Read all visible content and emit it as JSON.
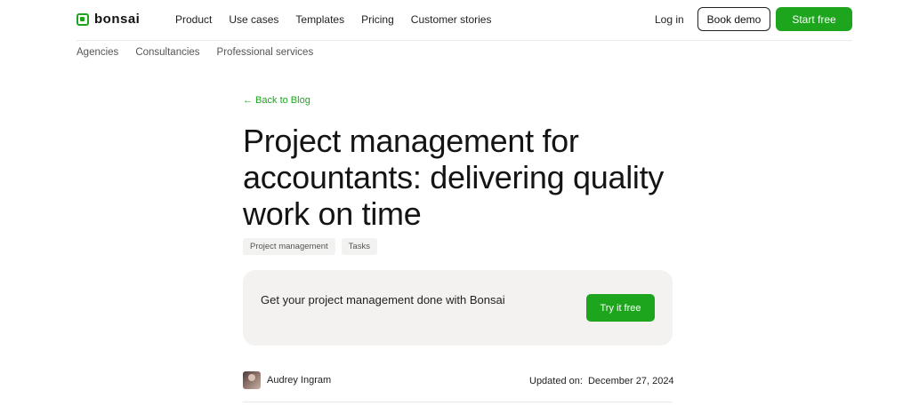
{
  "brand": {
    "name": "bonsai",
    "accent_color": "#1ea51e"
  },
  "nav": {
    "items": [
      {
        "label": "Product"
      },
      {
        "label": "Use cases"
      },
      {
        "label": "Templates"
      },
      {
        "label": "Pricing"
      },
      {
        "label": "Customer stories"
      }
    ],
    "login_label": "Log in",
    "book_demo_label": "Book demo",
    "start_free_label": "Start free"
  },
  "subnav": {
    "items": [
      {
        "label": "Agencies"
      },
      {
        "label": "Consultancies"
      },
      {
        "label": "Professional services"
      }
    ]
  },
  "article": {
    "back_link": "← Back to Blog",
    "title": "Project management for accountants: delivering quality work on time",
    "tags": [
      {
        "label": "Project management"
      },
      {
        "label": "Tasks"
      }
    ],
    "cta": {
      "text": "Get your project management done with Bonsai",
      "button_label": "Try it free"
    },
    "author": {
      "name": "Audrey Ingram"
    },
    "updated": {
      "label": "Updated on:",
      "date": "December 27, 2024"
    }
  }
}
